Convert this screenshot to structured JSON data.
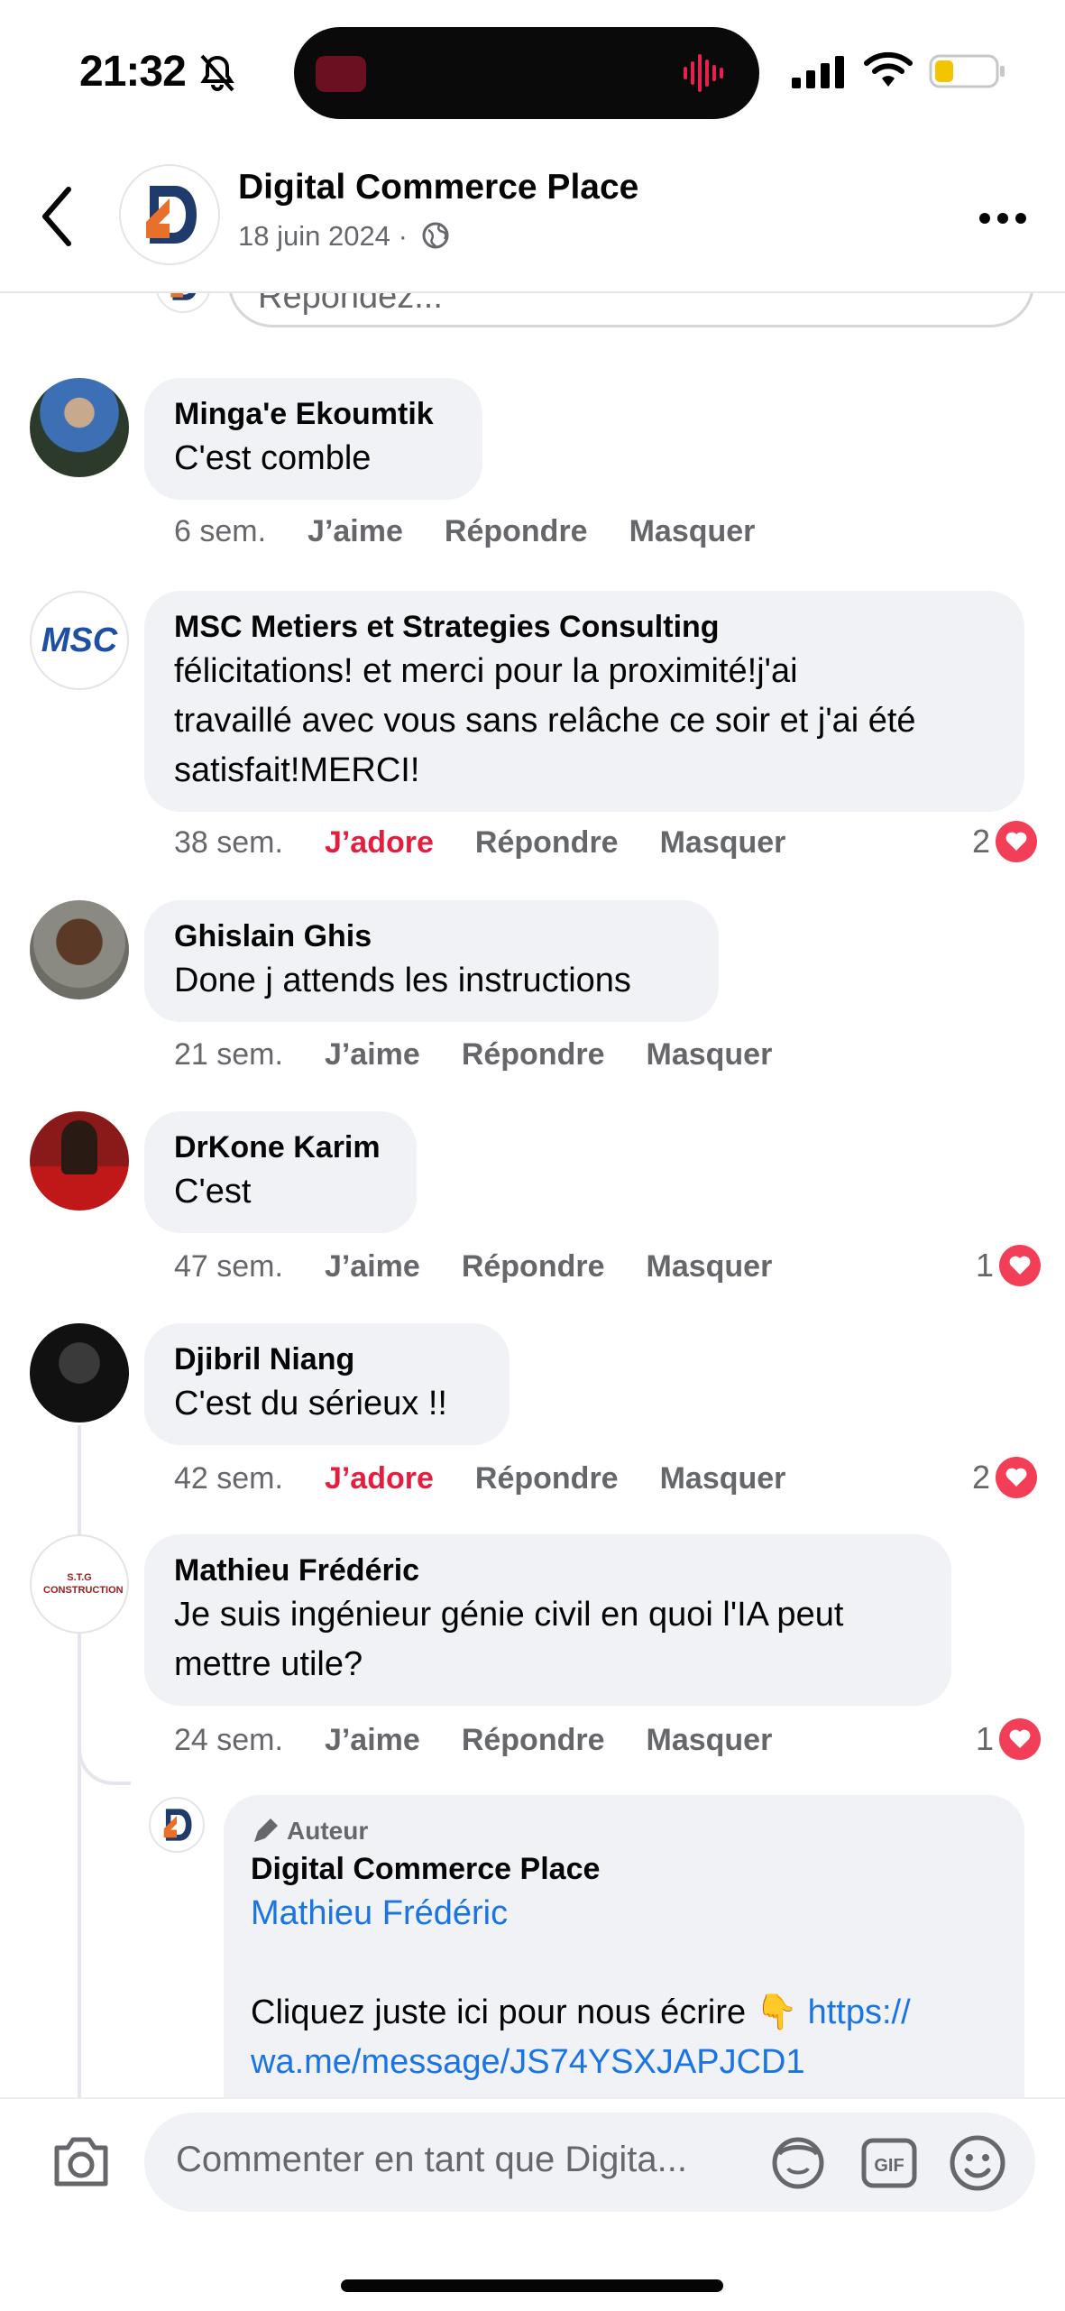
{
  "status_bar": {
    "time": "21:32"
  },
  "header": {
    "page_name": "Digital Commerce Place",
    "date": "18 juin 2024",
    "separator": "·"
  },
  "reply_box": {
    "placeholder": "Répondez..."
  },
  "comments": [
    {
      "author": "Minga'e Ekoumtik",
      "text": "C'est comble",
      "time": "6 sem.",
      "reaction_label": "J’aime",
      "reply_label": "Répondre",
      "hide_label": "Masquer"
    },
    {
      "author": "MSC Metiers et Strategies Consulting",
      "text_lines": [
        "félicitations! et merci pour la proximité!j'ai",
        "travaillé avec vous sans relâche ce soir et j'ai été",
        "satisfait!MERCI!"
      ],
      "time": "38 sem.",
      "reaction_label": "J’adore",
      "reply_label": "Répondre",
      "hide_label": "Masquer",
      "reactions": "2",
      "avatar_text": "MSC"
    },
    {
      "author": "Ghislain Ghis",
      "text": "Done j attends les instructions",
      "time": "21 sem.",
      "reaction_label": "J’aime",
      "reply_label": "Répondre",
      "hide_label": "Masquer"
    },
    {
      "author": "DrKone Karim",
      "text": "C'est",
      "time": "47 sem.",
      "reaction_label": "J’aime",
      "reply_label": "Répondre",
      "hide_label": "Masquer",
      "reactions": "1"
    },
    {
      "author": "Djibril Niang",
      "text": "C'est du sérieux !!",
      "time": "42 sem.",
      "reaction_label": "J’adore",
      "reply_label": "Répondre",
      "hide_label": "Masquer",
      "reactions": "2"
    },
    {
      "author": "Mathieu Frédéric",
      "text_lines": [
        "Je suis ingénieur génie civil en quoi l'IA peut",
        "mettre utile?"
      ],
      "time": "24 sem.",
      "reaction_label": "J’aime",
      "reply_label": "Répondre",
      "hide_label": "Masquer",
      "reactions": "1",
      "avatar_text": "S.T.G CONSTRUCTION"
    }
  ],
  "author_reply": {
    "badge": "Auteur",
    "author": "Digital Commerce Place",
    "mention": "Mathieu Frédéric",
    "text": "Cliquez juste ici pour nous écrire 👇 ",
    "link_line1": "https://",
    "link_line2": "wa.me/message/JS74YSXJAPJCD1"
  },
  "composer": {
    "placeholder": "Commenter en tant que Digita..."
  },
  "colors": {
    "accent_link": "#1b74e4",
    "love_red": "#e41e3f",
    "heart_bg": "#f33e58",
    "bubble_bg": "#f0f2f5"
  }
}
